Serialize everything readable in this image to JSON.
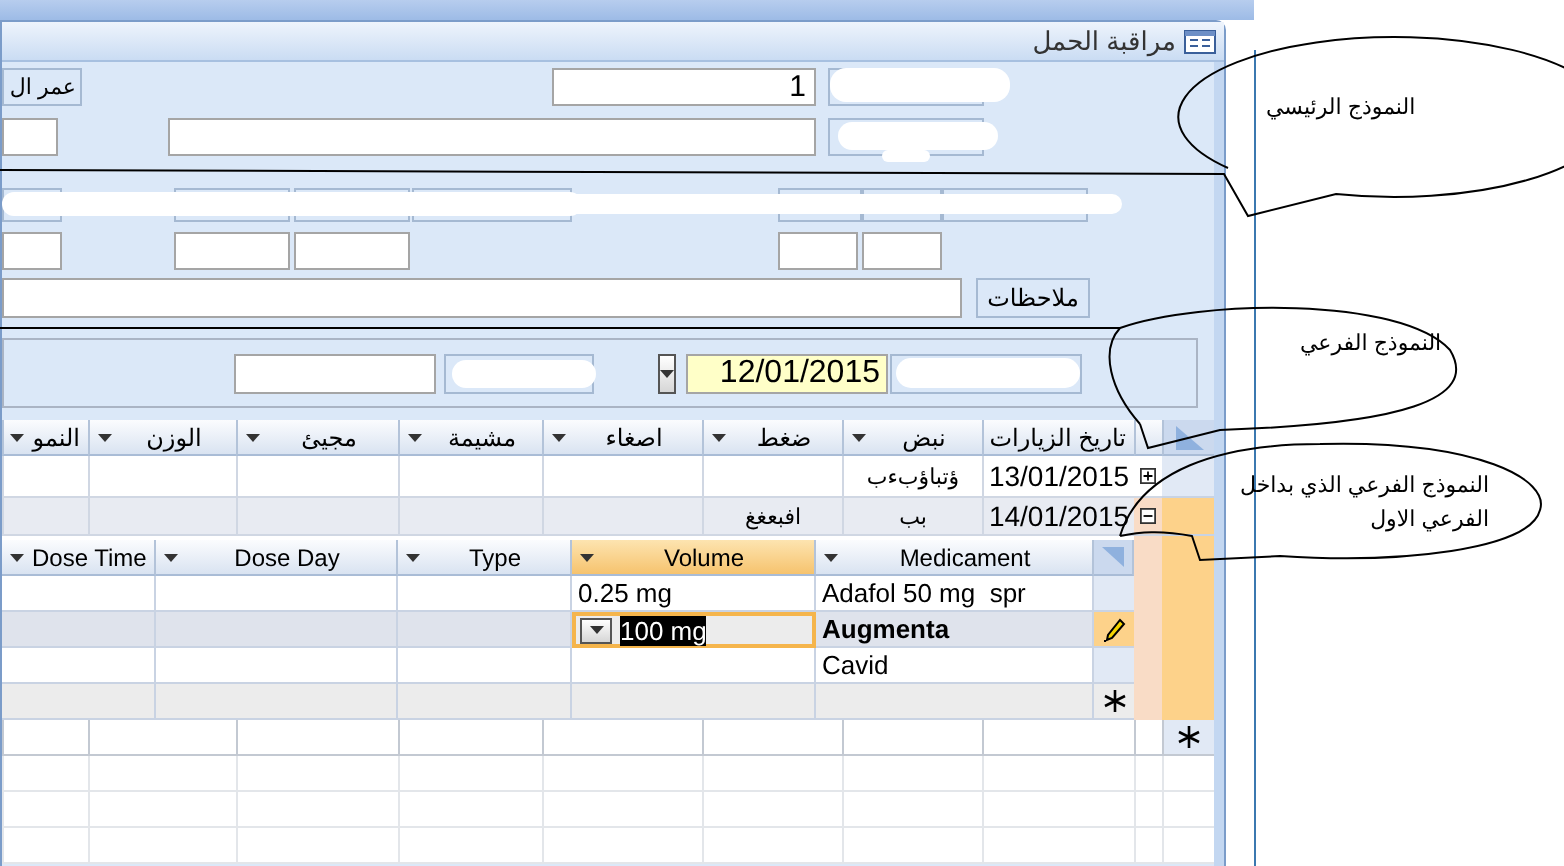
{
  "window": {
    "title": "مراقبة الحمل"
  },
  "main_form": {
    "age_label": "عمر ال",
    "number_field": {
      "value": "1"
    },
    "notes_label": "ملاحظات"
  },
  "subform": {
    "visit_date_field": {
      "value": "12/01/2015"
    }
  },
  "visits_grid": {
    "columns": [
      "تاريخ الزيارات",
      "نبض",
      "ضغط",
      "اصغاء",
      "مشيمة",
      "مجيئ",
      "الوزن",
      "النمو"
    ],
    "rows": [
      {
        "cells": [
          "13/01/2015",
          "ؤتباؤبءب"
        ],
        "expanded": false,
        "selected": false
      },
      {
        "cells": [
          "14/01/2015",
          "بب",
          "افبعغغ"
        ],
        "expanded": true,
        "selected": true
      }
    ]
  },
  "medications_grid": {
    "columns": [
      {
        "label": "Medicament",
        "selected": false
      },
      {
        "label": "Volume",
        "selected": true
      },
      {
        "label": "Type",
        "selected": false
      },
      {
        "label": "Dose Day",
        "selected": false
      },
      {
        "label": "Dose Time",
        "selected": false
      }
    ],
    "rows": [
      {
        "cells": [
          "Adafol 50 mg  spr",
          "0.25 mg"
        ],
        "editing": false
      },
      {
        "cells": [
          "Augmenta",
          "100 mg"
        ],
        "editing": true
      },
      {
        "cells": [
          "Cavid"
        ],
        "editing": false
      }
    ]
  },
  "callouts": [
    {
      "lines": [
        "النموذج الرئيسي"
      ]
    },
    {
      "lines": [
        "النموذج الفرعي"
      ]
    },
    {
      "lines": [
        "النموذج الفرعي الذي بداخل",
        "الفرعي الاول"
      ]
    }
  ]
}
